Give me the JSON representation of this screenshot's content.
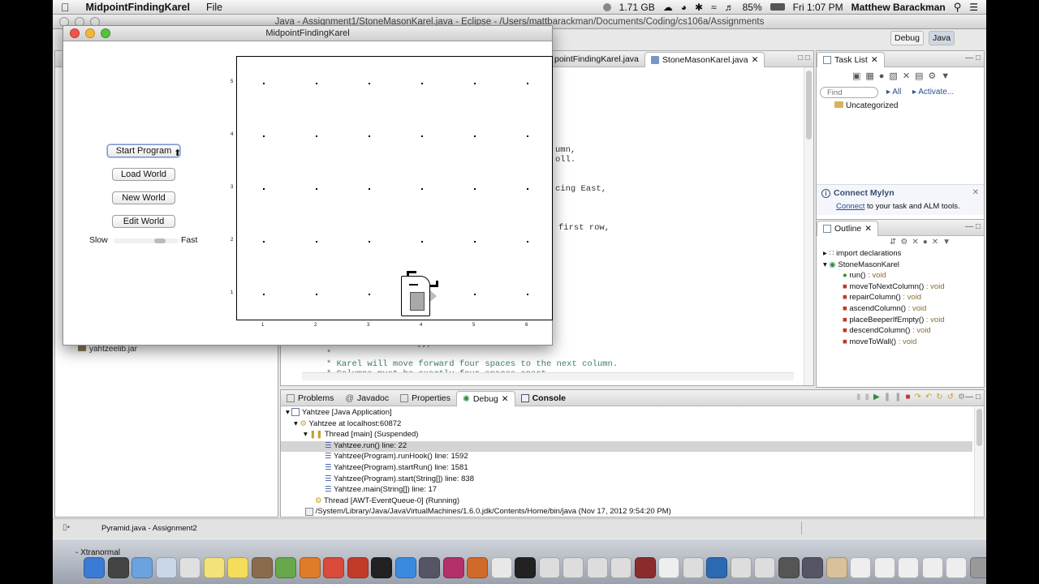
{
  "menubar": {
    "app_name": "MidpointFindingKarel",
    "menu_file": "File",
    "memory": "1.71 GB",
    "battery": "85%",
    "clock": "Fri 1:07 PM",
    "user": "Matthew Barackman"
  },
  "eclipse": {
    "title": "Java - Assignment1/StoneMasonKarel.java - Eclipse - /Users/mattbarackman/Documents/Coding/cs106a/Assignments",
    "perspectives": [
      "Debug",
      "Java"
    ],
    "editor_tabs": [
      "pointFindingKarel.java",
      "StoneMasonKarel.java"
    ],
    "code_fragments": [
      "umn,",
      "oll.",
      "cing East,",
      "first row,"
    ],
    "code_bottom": [
      "moveToNextColumn();",
      "*",
      "* Karel will move forward four spaces to the next column.",
      "* Columns must be exactly four spaces apart."
    ],
    "package_explorer_item": "yahtzeelib.jar",
    "task_list": {
      "title": "Task List",
      "find_placeholder": "Find",
      "all_label": "All",
      "activate_label": "Activate...",
      "category": "Uncategorized"
    },
    "mylyn": {
      "title": "Connect Mylyn",
      "link": "Connect",
      "text": " to your task and ALM tools."
    },
    "outline": {
      "title": "Outline",
      "items": [
        {
          "label": "import declarations",
          "type": "",
          "level": 0
        },
        {
          "label": "StoneMasonKarel",
          "type": "",
          "level": 0
        },
        {
          "label": "run()",
          "type": " : void",
          "level": 1
        },
        {
          "label": "moveToNextColumn()",
          "type": " : void",
          "level": 1
        },
        {
          "label": "repairColumn()",
          "type": " : void",
          "level": 1
        },
        {
          "label": "ascendColumn()",
          "type": " : void",
          "level": 1
        },
        {
          "label": "placeBeeperIfEmpty()",
          "type": " : void",
          "level": 1
        },
        {
          "label": "descendColumn()",
          "type": " : void",
          "level": 1
        },
        {
          "label": "moveToWall()",
          "type": " : void",
          "level": 1
        }
      ]
    },
    "bottom_tabs": [
      "Problems",
      "Javadoc",
      "Properties",
      "Debug",
      "Console"
    ],
    "debug_tree": [
      "Yahtzee [Java Application]",
      "Yahtzee at localhost:60872",
      "Thread [main] (Suspended)",
      "Yahtzee.run() line: 22",
      "Yahtzee(Program).runHook() line: 1592",
      "Yahtzee(Program).startRun() line: 1581",
      "Yahtzee(Program).start(String[]) line: 838",
      "Yahtzee.main(String[]) line: 17",
      "Thread [AWT-EventQueue-0] (Running)",
      "/System/Library/Java/JavaVirtualMachines/1.6.0.jdk/Contents/Home/bin/java (Nov 17, 2012 9:54:20 PM)"
    ],
    "status_bar": "Pyramid.java - Assignment2"
  },
  "karel": {
    "title": "MidpointFindingKarel",
    "buttons": [
      "Start Program",
      "Load World",
      "New World",
      "Edit World"
    ],
    "slow_label": "Slow",
    "fast_label": "Fast",
    "speed_level": 0.75,
    "rows": [
      "5",
      "4",
      "3",
      "2",
      "1"
    ],
    "cols": [
      "1",
      "2",
      "3",
      "4",
      "5",
      "6"
    ]
  },
  "dock": {
    "label": "- Xtranormal"
  }
}
